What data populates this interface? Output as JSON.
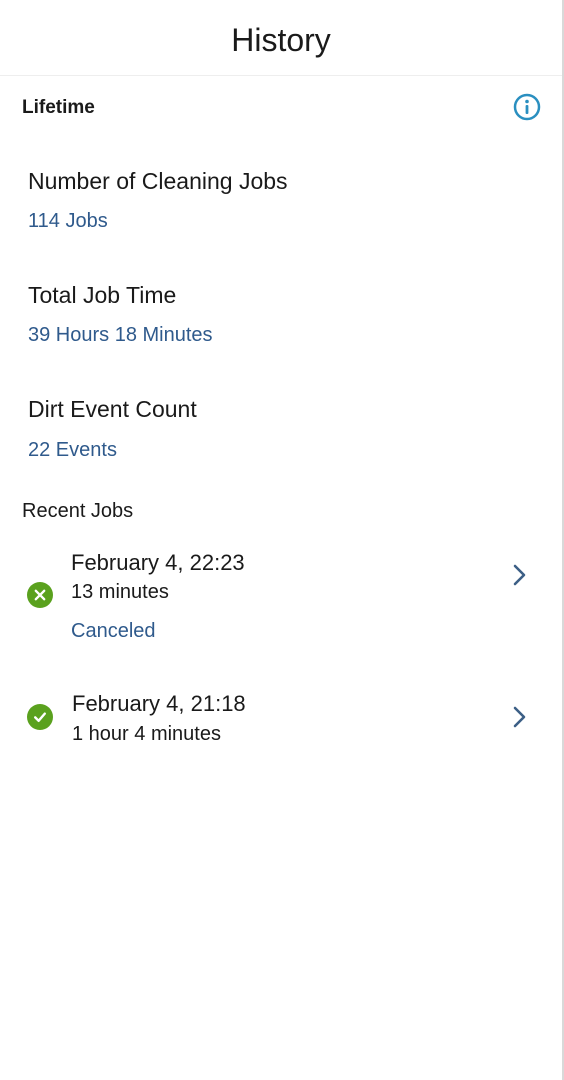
{
  "header": {
    "title": "History"
  },
  "lifetime": {
    "label": "Lifetime",
    "info_icon": "info-circle-icon",
    "stats": [
      {
        "title": "Number of Cleaning Jobs",
        "value": "114 Jobs"
      },
      {
        "title": "Total Job Time",
        "value": "39 Hours 18 Minutes"
      },
      {
        "title": "Dirt Event Count",
        "value": "22 Events"
      }
    ]
  },
  "recent": {
    "label": "Recent Jobs",
    "jobs": [
      {
        "date": "February 4, 22:23",
        "duration": "13 minutes",
        "status": "Canceled",
        "status_icon": "x-circle-icon"
      },
      {
        "date": "February 4, 21:18",
        "duration": "1 hour 4 minutes",
        "status_icon": "check-circle-icon"
      }
    ]
  },
  "colors": {
    "accent_blue": "#2f5a8c",
    "info_blue": "#2a8fc0",
    "success_green": "#5aa11e",
    "chevron": "#3c5f86"
  }
}
